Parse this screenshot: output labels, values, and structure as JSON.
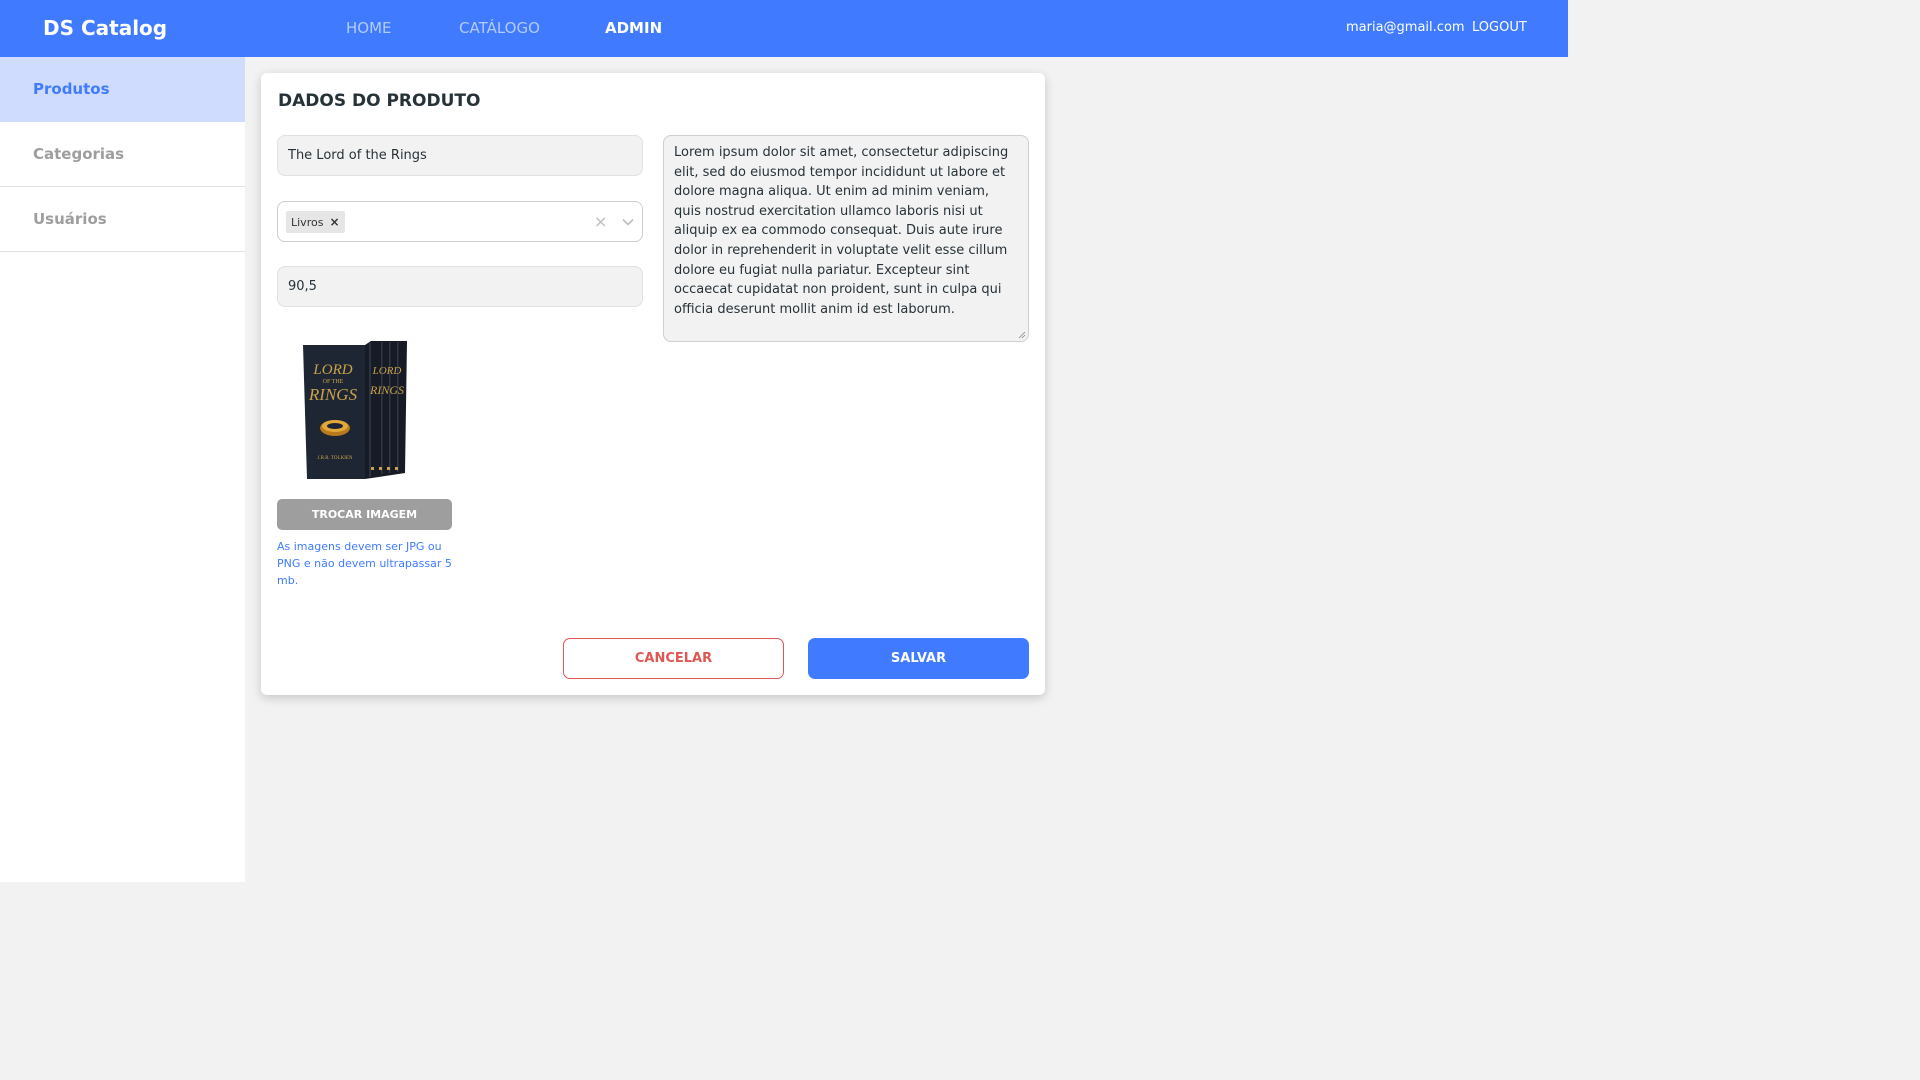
{
  "navbar": {
    "brand": "DS Catalog",
    "links": [
      {
        "label": "HOME",
        "active": false
      },
      {
        "label": "CATÁLOGO",
        "active": false
      },
      {
        "label": "ADMIN",
        "active": true
      }
    ],
    "user_email": "maria@gmail.com",
    "logout_label": "LOGOUT",
    "color": "#407bff"
  },
  "sidebar": {
    "items": [
      {
        "label": "Produtos",
        "active": true
      },
      {
        "label": "Categorias",
        "active": false
      },
      {
        "label": "Usuários",
        "active": false
      }
    ]
  },
  "form": {
    "title": "DADOS DO PRODUTO",
    "name_value": "The Lord of the Rings",
    "categories_selected": [
      "Livros"
    ],
    "price_value": "90,5",
    "description_value": "Lorem ipsum dolor sit amet, consectetur adipiscing elit, sed do eiusmod tempor incididunt ut labore et dolore magna aliqua. Ut enim ad minim veniam, quis nostrud exercitation ullamco laboris nisi ut aliquip ex ea commodo consequat. Duis aute irure dolor in reprehenderit in voluptate velit esse cillum dolore eu fugiat nulla pariatur. Excepteur sint occaecat cupidatat non proident, sunt in culpa qui officia deserunt mollit anim id est laborum.",
    "change_image_label": "TROCAR IMAGEM",
    "image_help": "As imagens devem ser JPG ou PNG e não devem ultrapassar 5 mb.",
    "cancel_label": "CANCELAR",
    "save_label": "SALVAR"
  },
  "colors": {
    "primary": "#407bff",
    "danger": "#df5753",
    "secondary": "#9e9e9e"
  }
}
